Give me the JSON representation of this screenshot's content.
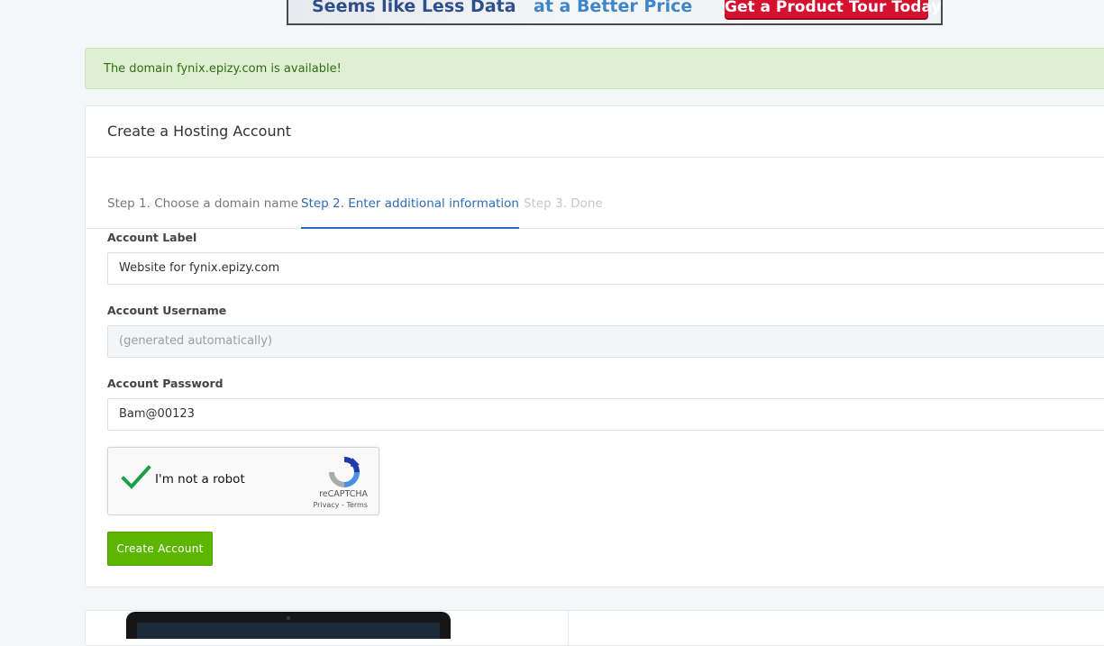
{
  "banner": {
    "text_left": "Seems like Less Data",
    "text_middle": "at a Better Price",
    "cta_label": "Get a Product Tour Today"
  },
  "alert": {
    "message": "The domain fynix.epizy.com is available!"
  },
  "card": {
    "title": "Create a Hosting Account",
    "steps": [
      {
        "label": "Step 1. Choose a domain name",
        "state": "completed"
      },
      {
        "label": "Step 2. Enter additional information",
        "state": "active"
      },
      {
        "label": "Step 3. Done",
        "state": "upcoming"
      }
    ],
    "fields": {
      "account_label": {
        "label": "Account Label",
        "value": "Website for fynix.epizy.com"
      },
      "account_username": {
        "label": "Account Username",
        "placeholder": "(generated automatically)"
      },
      "account_password": {
        "label": "Account Password",
        "value": "Bam@00123"
      }
    },
    "recaptcha": {
      "label": "I'm not a robot",
      "checked": true,
      "brand": "reCAPTCHA",
      "links": "Privacy - Terms"
    },
    "submit_label": "Create Account"
  },
  "colors": {
    "accent_blue": "#2f6bb8",
    "success_green": "#5cb600",
    "alert_bg": "#dff0d2",
    "banner_cta": "#d6112f"
  }
}
